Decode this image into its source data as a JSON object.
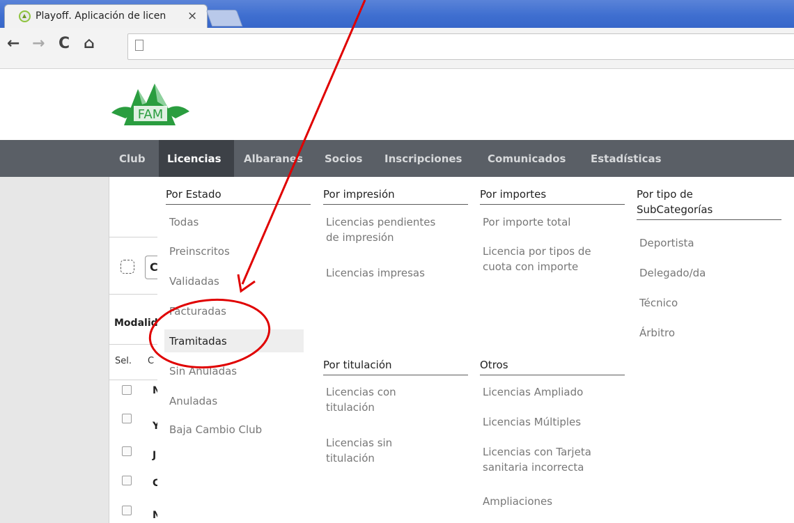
{
  "browser": {
    "tab_title": "Playoff. Aplicación de licen",
    "tab_close": "×",
    "back": "←",
    "forward": "→",
    "reload": "C",
    "home": "⌂"
  },
  "logo": {
    "text": "FAM"
  },
  "nav": {
    "items": [
      "Club",
      "Licencias",
      "Albaranes",
      "Socios",
      "Inscripciones",
      "Comunicados",
      "Estadísticas"
    ],
    "active": "Licencias"
  },
  "background": {
    "checkbox_all_initial": "C",
    "modalidad_label": "Modalid",
    "table_headers": [
      "Sel.",
      "C"
    ],
    "row_initials": [
      "N",
      "Y",
      "J",
      "C",
      "N"
    ]
  },
  "menu": {
    "por_estado": {
      "heading": "Por Estado",
      "items": [
        "Todas",
        "Preinscritos",
        "Validadas",
        "Facturadas",
        "Tramitadas",
        "Sin Anuladas",
        "Anuladas",
        "Baja Cambio Club"
      ]
    },
    "por_impresion": {
      "heading": "Por impresión",
      "items": [
        [
          "Licencias pendientes",
          "de impresión"
        ],
        [
          "Licencias impresas"
        ]
      ]
    },
    "por_importes": {
      "heading": "Por importes",
      "items": [
        [
          "Por importe total"
        ],
        [
          "Licencia por tipos de",
          "cuota con importe"
        ]
      ]
    },
    "por_subcategorias": {
      "heading_line1": "Por tipo de",
      "heading_line2": "SubCategorías",
      "items": [
        "Deportista",
        "Delegado/da",
        "Técnico",
        "Árbitro"
      ]
    },
    "por_titulacion": {
      "heading": "Por titulación",
      "items": [
        [
          "Licencias con",
          "titulación"
        ],
        [
          "Licencias sin",
          "titulación"
        ]
      ]
    },
    "otros": {
      "heading": "Otros",
      "items": [
        [
          "Licencias Ampliado"
        ],
        [
          "Licencias Múltiples"
        ],
        [
          "Licencias con Tarjeta",
          "sanitaria incorrecta"
        ],
        [
          "Ampliaciones"
        ]
      ]
    },
    "highlighted_item": "Tramitadas"
  },
  "colors": {
    "nav_bg": "#5a5f66",
    "nav_active_bg": "#3d4147",
    "annotation": "#e00000",
    "logo_green": "#2a9d3f"
  }
}
